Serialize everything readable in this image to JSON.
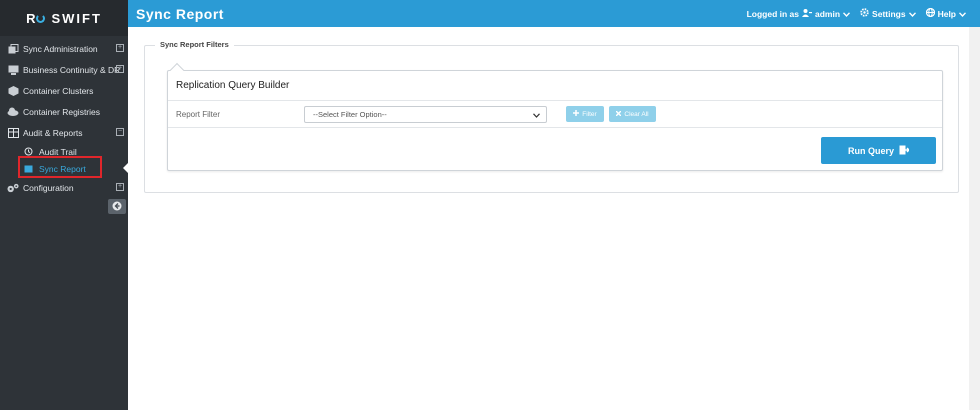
{
  "app": {
    "logo_text": "SWIFT",
    "logo_prefix": "R"
  },
  "header": {
    "title": "Sync Report",
    "logged_in_label": "Logged in as",
    "user": "admin",
    "settings_label": "Settings",
    "help_label": "Help"
  },
  "sidebar": {
    "items": [
      {
        "label": "Sync Administration",
        "icon": "sync-icon",
        "toggle": "+"
      },
      {
        "label": "Business Continuity & DR",
        "icon": "server-icon",
        "toggle": "+"
      },
      {
        "label": "Container Clusters",
        "icon": "cluster-icon"
      },
      {
        "label": "Container Registries",
        "icon": "cloud-icon"
      },
      {
        "label": "Audit & Reports",
        "icon": "table-icon",
        "toggle": "−"
      },
      {
        "label": "Configuration",
        "icon": "gears-icon",
        "toggle": "+"
      }
    ],
    "sub_items": [
      {
        "label": "Audit Trail",
        "icon": "history-icon"
      },
      {
        "label": "Sync Report",
        "icon": "report-icon",
        "active": true
      }
    ]
  },
  "content": {
    "legend": "Sync Report Filters",
    "panel_title": "Replication Query Builder",
    "filter_label": "Report Filter",
    "select_value": "--Select Filter Option--",
    "filter_button": "Filter",
    "clear_button": "Clear All",
    "run_button": "Run Query"
  },
  "colors": {
    "header": "#2b9bd5",
    "sidebar": "#2e3338",
    "accent": "#39a9dc",
    "highlight": "#e0262b"
  }
}
